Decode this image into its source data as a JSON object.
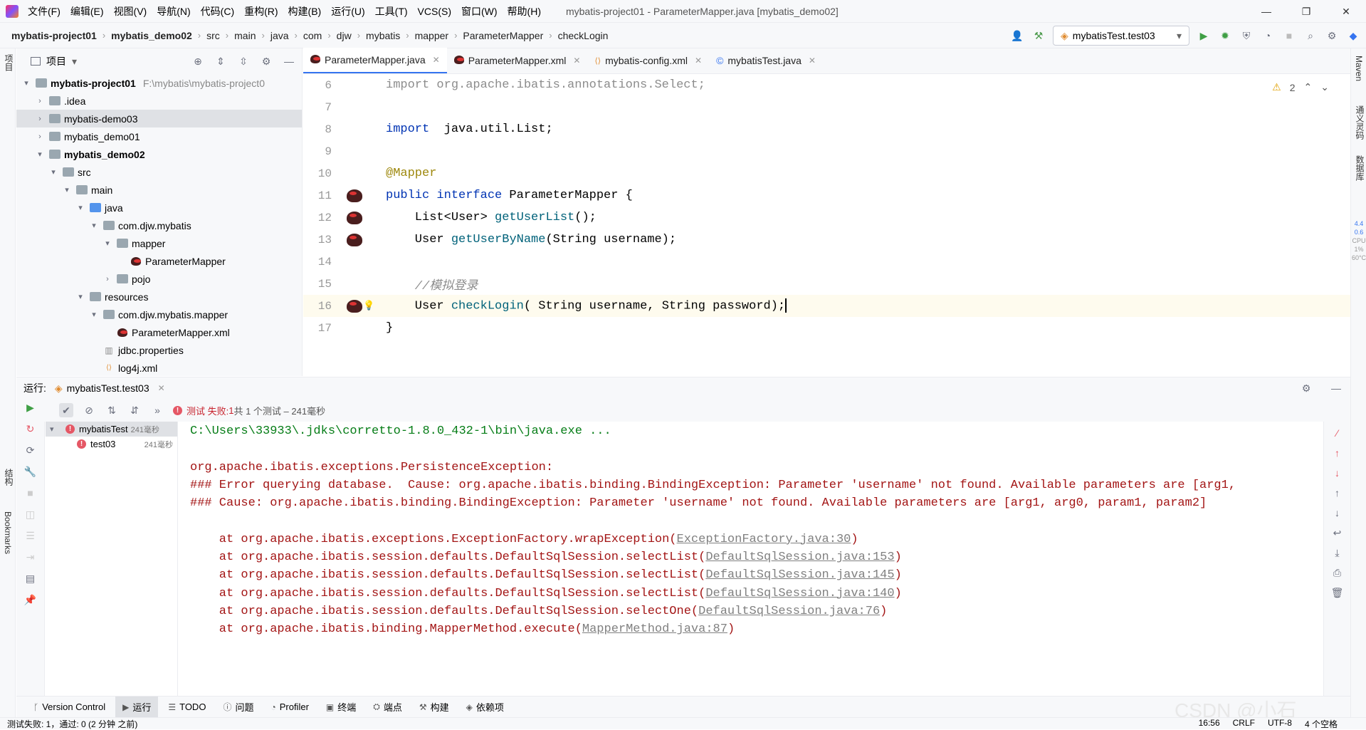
{
  "menubar": {
    "items": [
      "文件(F)",
      "编辑(E)",
      "视图(V)",
      "导航(N)",
      "代码(C)",
      "重构(R)",
      "构建(B)",
      "运行(U)",
      "工具(T)",
      "VCS(S)",
      "窗口(W)",
      "帮助(H)"
    ],
    "title": "mybatis-project01 - ParameterMapper.java [mybatis_demo02]"
  },
  "breadcrumb": [
    "mybatis-project01",
    "mybatis_demo02",
    "src",
    "main",
    "java",
    "com",
    "djw",
    "mybatis",
    "mapper",
    "ParameterMapper",
    "checkLogin"
  ],
  "run_config": "mybatisTest.test03",
  "project": {
    "header": "项目",
    "tree": [
      {
        "label": "mybatis-project01",
        "path": "F:\\mybatis\\mybatis-project0",
        "bold": true,
        "arrow": "▾",
        "indent": 0,
        "type": "folder"
      },
      {
        "label": ".idea",
        "arrow": "›",
        "indent": 1,
        "type": "folder"
      },
      {
        "label": "mybatis-demo03",
        "arrow": "›",
        "indent": 1,
        "type": "folder",
        "selected": true
      },
      {
        "label": "mybatis_demo01",
        "arrow": "›",
        "indent": 1,
        "type": "folder"
      },
      {
        "label": "mybatis_demo02",
        "arrow": "▾",
        "indent": 1,
        "type": "folder",
        "bold": true
      },
      {
        "label": "src",
        "arrow": "▾",
        "indent": 2,
        "type": "folder"
      },
      {
        "label": "main",
        "arrow": "▾",
        "indent": 3,
        "type": "folder"
      },
      {
        "label": "java",
        "arrow": "▾",
        "indent": 4,
        "type": "folder-blue"
      },
      {
        "label": "com.djw.mybatis",
        "arrow": "▾",
        "indent": 5,
        "type": "folder"
      },
      {
        "label": "mapper",
        "arrow": "▾",
        "indent": 6,
        "type": "folder"
      },
      {
        "label": "ParameterMapper",
        "arrow": "",
        "indent": 7,
        "type": "bird"
      },
      {
        "label": "pojo",
        "arrow": "›",
        "indent": 6,
        "type": "folder"
      },
      {
        "label": "resources",
        "arrow": "▾",
        "indent": 4,
        "type": "folder"
      },
      {
        "label": "com.djw.mybatis.mapper",
        "arrow": "▾",
        "indent": 5,
        "type": "folder"
      },
      {
        "label": "ParameterMapper.xml",
        "arrow": "",
        "indent": 6,
        "type": "bird"
      },
      {
        "label": "jdbc.properties",
        "arrow": "",
        "indent": 5,
        "type": "props"
      },
      {
        "label": "log4j.xml",
        "arrow": "",
        "indent": 5,
        "type": "xml"
      }
    ]
  },
  "tabs": [
    {
      "label": "ParameterMapper.java",
      "active": true
    },
    {
      "label": "ParameterMapper.xml"
    },
    {
      "label": "mybatis-config.xml"
    },
    {
      "label": "mybatisTest.java"
    }
  ],
  "editor": {
    "warnings": "2",
    "lines": [
      {
        "n": "6",
        "bird": false,
        "parts": [
          [
            "gr",
            "import org.apache.ibatis.annotations.Select;"
          ]
        ]
      },
      {
        "n": "7",
        "bird": false,
        "parts": []
      },
      {
        "n": "8",
        "bird": false,
        "parts": [
          [
            "kw",
            "import"
          ],
          [
            "",
            "  java.util.List;"
          ]
        ]
      },
      {
        "n": "9",
        "bird": false,
        "parts": []
      },
      {
        "n": "10",
        "bird": false,
        "parts": [
          [
            "an",
            "@Mapper"
          ]
        ]
      },
      {
        "n": "11",
        "bird": true,
        "parts": [
          [
            "kw",
            "public interface"
          ],
          [
            "",
            " ParameterMapper {"
          ]
        ]
      },
      {
        "n": "12",
        "bird": true,
        "parts": [
          [
            "",
            "    List<User> "
          ],
          [
            "fn",
            "getUserList"
          ],
          [
            "",
            "();"
          ]
        ]
      },
      {
        "n": "13",
        "bird": true,
        "parts": [
          [
            "",
            "    User "
          ],
          [
            "fn",
            "getUserByName"
          ],
          [
            "",
            "(String username);"
          ]
        ]
      },
      {
        "n": "14",
        "bird": false,
        "parts": []
      },
      {
        "n": "15",
        "bird": false,
        "parts": [
          [
            "cm",
            "    //模拟登录"
          ]
        ]
      },
      {
        "n": "16",
        "bird": true,
        "cur": true,
        "parts": [
          [
            "",
            "    User "
          ],
          [
            "fn",
            "checkLogin"
          ],
          [
            "",
            "( String username, String password);"
          ]
        ]
      },
      {
        "n": "17",
        "bird": false,
        "parts": [
          [
            "",
            "}"
          ]
        ]
      }
    ]
  },
  "run": {
    "label": "运行:",
    "tab": "mybatisTest.test03",
    "status_fail": "测试 失败:",
    "status_count": "1",
    "status_rest": "共 1 个测试 – 241毫秒",
    "tests": [
      {
        "name": "mybatisTest",
        "time": "241毫秒"
      },
      {
        "name": "test03",
        "time": "241毫秒"
      }
    ],
    "console": [
      {
        "cls": "cmd",
        "text": "C:\\Users\\33933\\.jdks\\corretto-1.8.0_432-1\\bin\\java.exe ..."
      },
      {
        "cls": "",
        "text": ""
      },
      {
        "cls": "",
        "text": "org.apache.ibatis.exceptions.PersistenceException: "
      },
      {
        "cls": "",
        "text": "### Error querying database.  Cause: org.apache.ibatis.binding.BindingException: Parameter 'username' not found. Available parameters are [arg1,"
      },
      {
        "cls": "",
        "text": "### Cause: org.apache.ibatis.binding.BindingException: Parameter 'username' not found. Available parameters are [arg1, arg0, param1, param2]"
      },
      {
        "cls": "",
        "text": ""
      },
      {
        "cls": "",
        "text": "    at org.apache.ibatis.exceptions.ExceptionFactory.wrapException(",
        "link": "ExceptionFactory.java:30",
        "tail": ")"
      },
      {
        "cls": "",
        "text": "    at org.apache.ibatis.session.defaults.DefaultSqlSession.selectList(",
        "link": "DefaultSqlSession.java:153",
        "tail": ")"
      },
      {
        "cls": "",
        "text": "    at org.apache.ibatis.session.defaults.DefaultSqlSession.selectList(",
        "link": "DefaultSqlSession.java:145",
        "tail": ")"
      },
      {
        "cls": "",
        "text": "    at org.apache.ibatis.session.defaults.DefaultSqlSession.selectList(",
        "link": "DefaultSqlSession.java:140",
        "tail": ")"
      },
      {
        "cls": "",
        "text": "    at org.apache.ibatis.session.defaults.DefaultSqlSession.selectOne(",
        "link": "DefaultSqlSession.java:76",
        "tail": ")"
      },
      {
        "cls": "",
        "text": "    at org.apache.ibatis.binding.MapperMethod.execute(",
        "link": "MapperMethod.java:87",
        "tail": ")"
      }
    ]
  },
  "toolwindows": [
    "Version Control",
    "运行",
    "TODO",
    "问题",
    "Profiler",
    "终端",
    "端点",
    "构建",
    "依赖项"
  ],
  "statusbar": {
    "left": "测试失败: 1，通过: 0 (2 分钟 之前)",
    "right": [
      "16:56",
      "CRLF",
      "UTF-8",
      "4 个空格"
    ]
  },
  "side": {
    "left_top": "项目",
    "left_mid": "结构",
    "left_bottom": "Bookmarks",
    "right": [
      "Maven",
      "通义灵码",
      "数据库"
    ],
    "meter": [
      "4.4",
      "0.6",
      "CPU",
      "1%",
      "60°C"
    ]
  },
  "watermark": "CSDN @小石"
}
